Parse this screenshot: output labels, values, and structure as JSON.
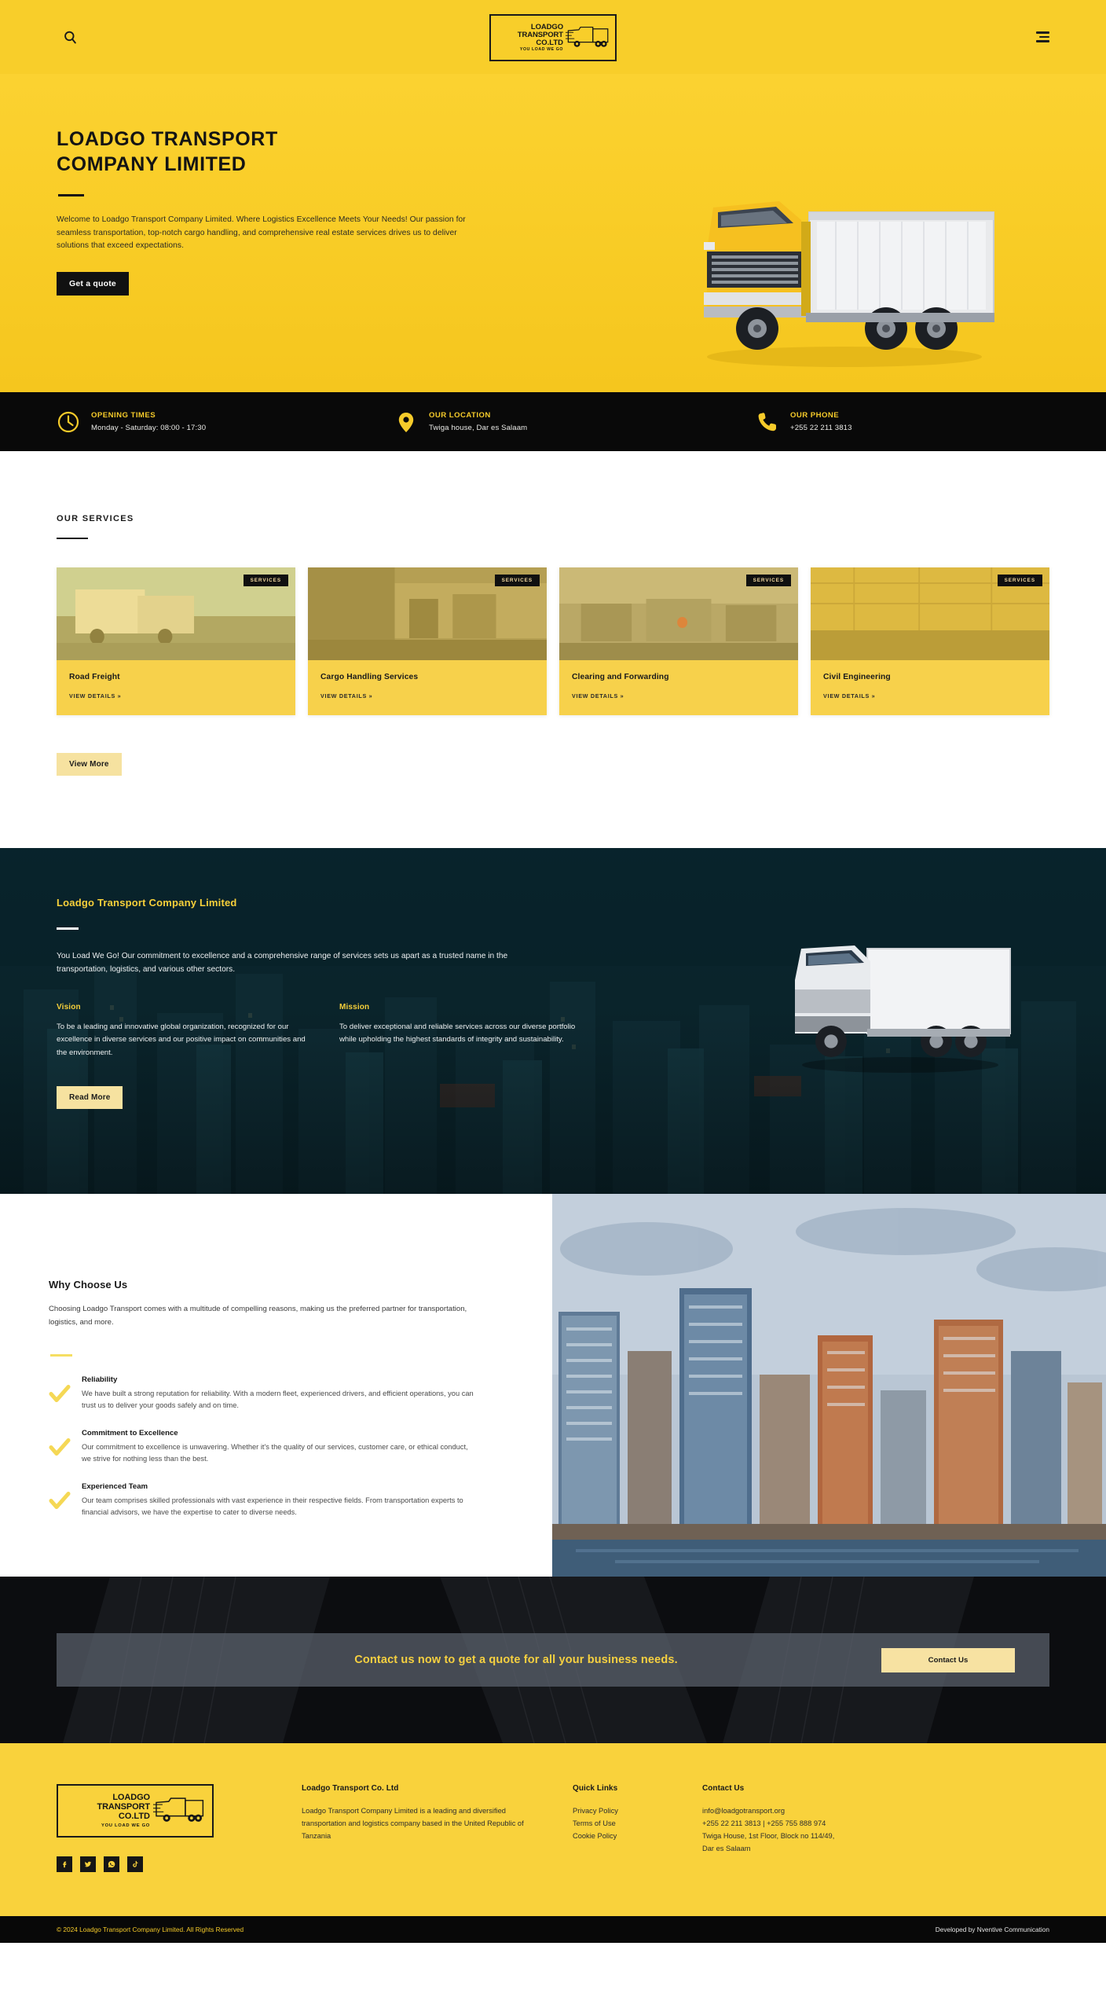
{
  "header": {
    "search_icon": "search-icon",
    "menu_icon": "hamburger-menu-icon",
    "logo": {
      "line1": "LOADGO TRANSPORT",
      "line2": "CO.LTD",
      "tagline": "YOU LOAD WE GO"
    }
  },
  "hero": {
    "title_line1": "LOADGO TRANSPORT",
    "title_line2": "COMPANY LIMITED",
    "paragraph": "Welcome to Loadgo Transport Company Limited. Where Logistics Excellence Meets Your Needs! Our passion for seamless transportation, top-notch cargo handling, and comprehensive real estate services drives us to deliver solutions that exceed expectations.",
    "cta_label": "Get a quote"
  },
  "infobar": {
    "items": [
      {
        "icon": "clock-icon",
        "title": "OPENING TIMES",
        "value": "Monday - Saturday: 08:00 - 17:30"
      },
      {
        "icon": "location-pin-icon",
        "title": "OUR LOCATION",
        "value": "Twiga house, Dar es Salaam"
      },
      {
        "icon": "phone-icon",
        "title": "OUR PHONE",
        "value": "+255 22 211 3813"
      }
    ]
  },
  "services": {
    "kicker": "OUR SERVICES",
    "badge_label": "SERVICES",
    "view_details_label": "VIEW DETAILS »",
    "view_more_label": "View More",
    "cards": [
      {
        "title": "Road Freight"
      },
      {
        "title": "Cargo Handling Services"
      },
      {
        "title": "Clearing and Forwarding"
      },
      {
        "title": "Civil Engineering"
      }
    ]
  },
  "about": {
    "heading": "Loadgo Transport Company Limited",
    "paragraph": "You Load We Go! Our commitment to excellence and a comprehensive range of services sets us apart as a trusted name in the transportation, logistics, and various other sectors.",
    "vision_title": "Vision",
    "vision_text": "To be a leading and innovative global organization, recognized for our excellence in diverse services and our positive impact on communities and the environment.",
    "mission_title": "Mission",
    "mission_text": "To deliver exceptional and reliable services across our diverse portfolio while upholding the highest standards of integrity and sustainability.",
    "cta_label": "Read More"
  },
  "why": {
    "heading": "Why Choose Us",
    "paragraph": "Choosing Loadgo Transport  comes with a multitude of compelling reasons, making us the preferred partner for transportation, logistics, and more.",
    "features": [
      {
        "icon": "check-icon",
        "title": "Reliability",
        "text": "We have built a strong reputation for reliability. With a modern fleet, experienced drivers, and efficient operations, you can trust us to deliver your goods safely and on time."
      },
      {
        "icon": "check-icon",
        "title": "Commitment to Excellence",
        "text": "Our commitment to excellence is unwavering. Whether it's the quality of our services, customer care, or ethical conduct, we strive for nothing less than the best."
      },
      {
        "icon": "check-icon",
        "title": "Experienced Team",
        "text": "Our team comprises skilled professionals with vast experience in their respective fields. From transportation experts to financial advisors, we have the expertise to cater to diverse needs."
      }
    ]
  },
  "cta": {
    "text": "Contact us now to get a quote for all your business needs.",
    "button_label": "Contact Us"
  },
  "footer": {
    "logo": {
      "line1": "LOADGO TRANSPORT",
      "line2": "CO.LTD",
      "tagline": "YOU LOAD WE GO"
    },
    "socials": [
      {
        "icon": "facebook-icon"
      },
      {
        "icon": "twitter-icon"
      },
      {
        "icon": "whatsapp-icon"
      },
      {
        "icon": "tiktok-icon"
      }
    ],
    "about_title": "Loadgo Transport Co. Ltd",
    "about_text": "Loadgo Transport Company Limited is a leading and diversified transportation and logistics company based in the United Republic of Tanzania",
    "links_title": "Quick Links",
    "links": [
      {
        "label": "Privacy Policy"
      },
      {
        "label": "Terms of Use"
      },
      {
        "label": "Cookie Policy"
      }
    ],
    "contact_title": "Contact Us",
    "contact_lines": [
      {
        "text": "info@loadgotransport.org"
      },
      {
        "text": "+255 22 211 3813 | +255 755 888 974"
      },
      {
        "text": "Twiga House, 1st Floor, Block no 114/49,"
      },
      {
        "text": "Dar es Salaam"
      }
    ]
  },
  "bottombar": {
    "copyright": "© 2024 Loadgo Transport Company Limited. All Rights Reserved",
    "credit": "Developed by Nventive Communication"
  },
  "colors": {
    "brand_yellow": "#f8ce2a",
    "card_yellow": "#f7d14b",
    "pale_yellow": "#f6e2a0",
    "dark": "#090909",
    "accent_gold": "#f6cb2a"
  }
}
